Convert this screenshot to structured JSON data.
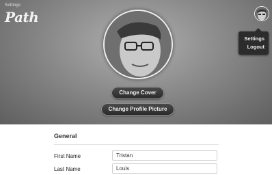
{
  "header": {
    "subtitle": "Settings",
    "app_name": "Path",
    "profile_photo": "profile-photo",
    "user_avatar": "user-avatar"
  },
  "menu": {
    "settings_label": "Settings",
    "logout_label": "Logout"
  },
  "actions": {
    "change_cover_label": "Change Cover",
    "change_profile_picture_label": "Change Profile Picture"
  },
  "general": {
    "title": "General",
    "first_name_label": "First Name",
    "first_name_value": "Tristan",
    "last_name_label": "Last Name",
    "last_name_value": "Louis"
  }
}
